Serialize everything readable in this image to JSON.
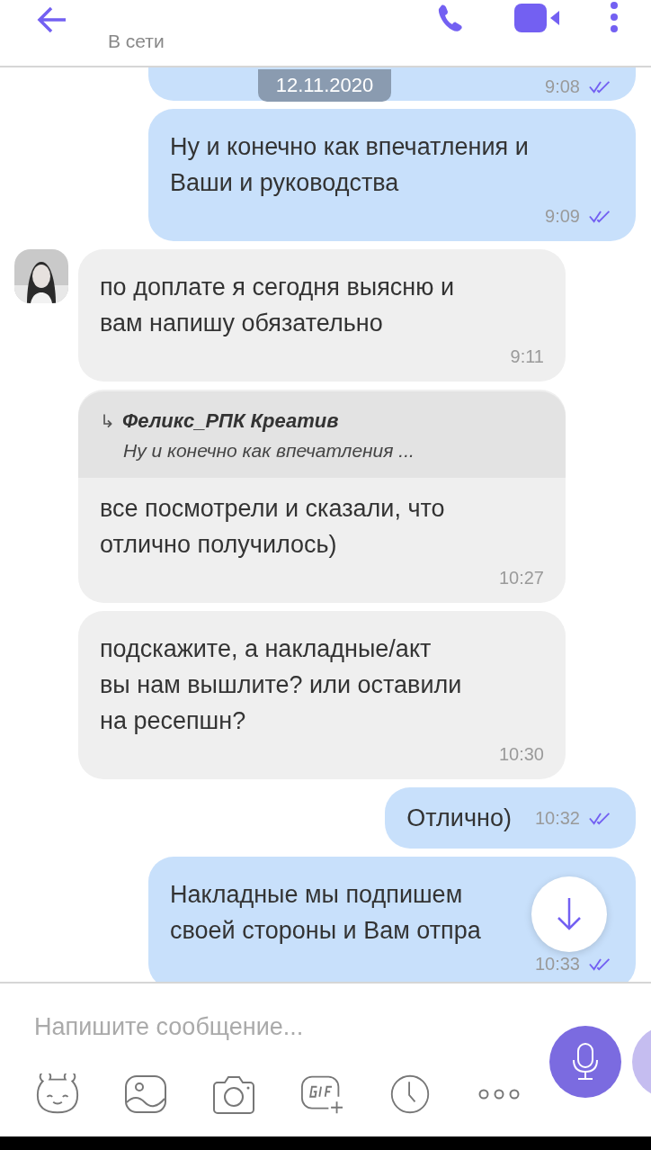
{
  "header": {
    "status": "В сети"
  },
  "date_badge": "12.11.2020",
  "messages": [
    {
      "kind": "out",
      "cut": true,
      "time": "9:08",
      "read": true
    },
    {
      "kind": "out",
      "text": "Ну и конечно как впечатления и\nВаши и руководства",
      "time": "9:09",
      "read": true
    },
    {
      "kind": "in",
      "avatar": true,
      "text": "по доплате я сегодня выясню и\nвам напишу обязательно",
      "time": "9:11"
    },
    {
      "kind": "in",
      "reply": {
        "arrow": "↳",
        "author": "Феликс_РПК Креатив",
        "text": "Ну и конечно как впечатления ..."
      },
      "text": "все посмотрели и сказали, что\nотлично получилось)",
      "time": "10:27"
    },
    {
      "kind": "in",
      "text": "подскажите, а накладные/акт\nвы нам вышлите? или оставили\nна ресепшн?",
      "time": "10:30"
    },
    {
      "kind": "out",
      "inline": true,
      "text": "Отлично)",
      "time": "10:32",
      "read": true
    },
    {
      "kind": "out",
      "text": "Накладные мы подпишем\nсвоей стороны и Вам отпра",
      "time": "10:33",
      "read": true
    }
  ],
  "composer": {
    "placeholder": "Напишите сообщение..."
  }
}
